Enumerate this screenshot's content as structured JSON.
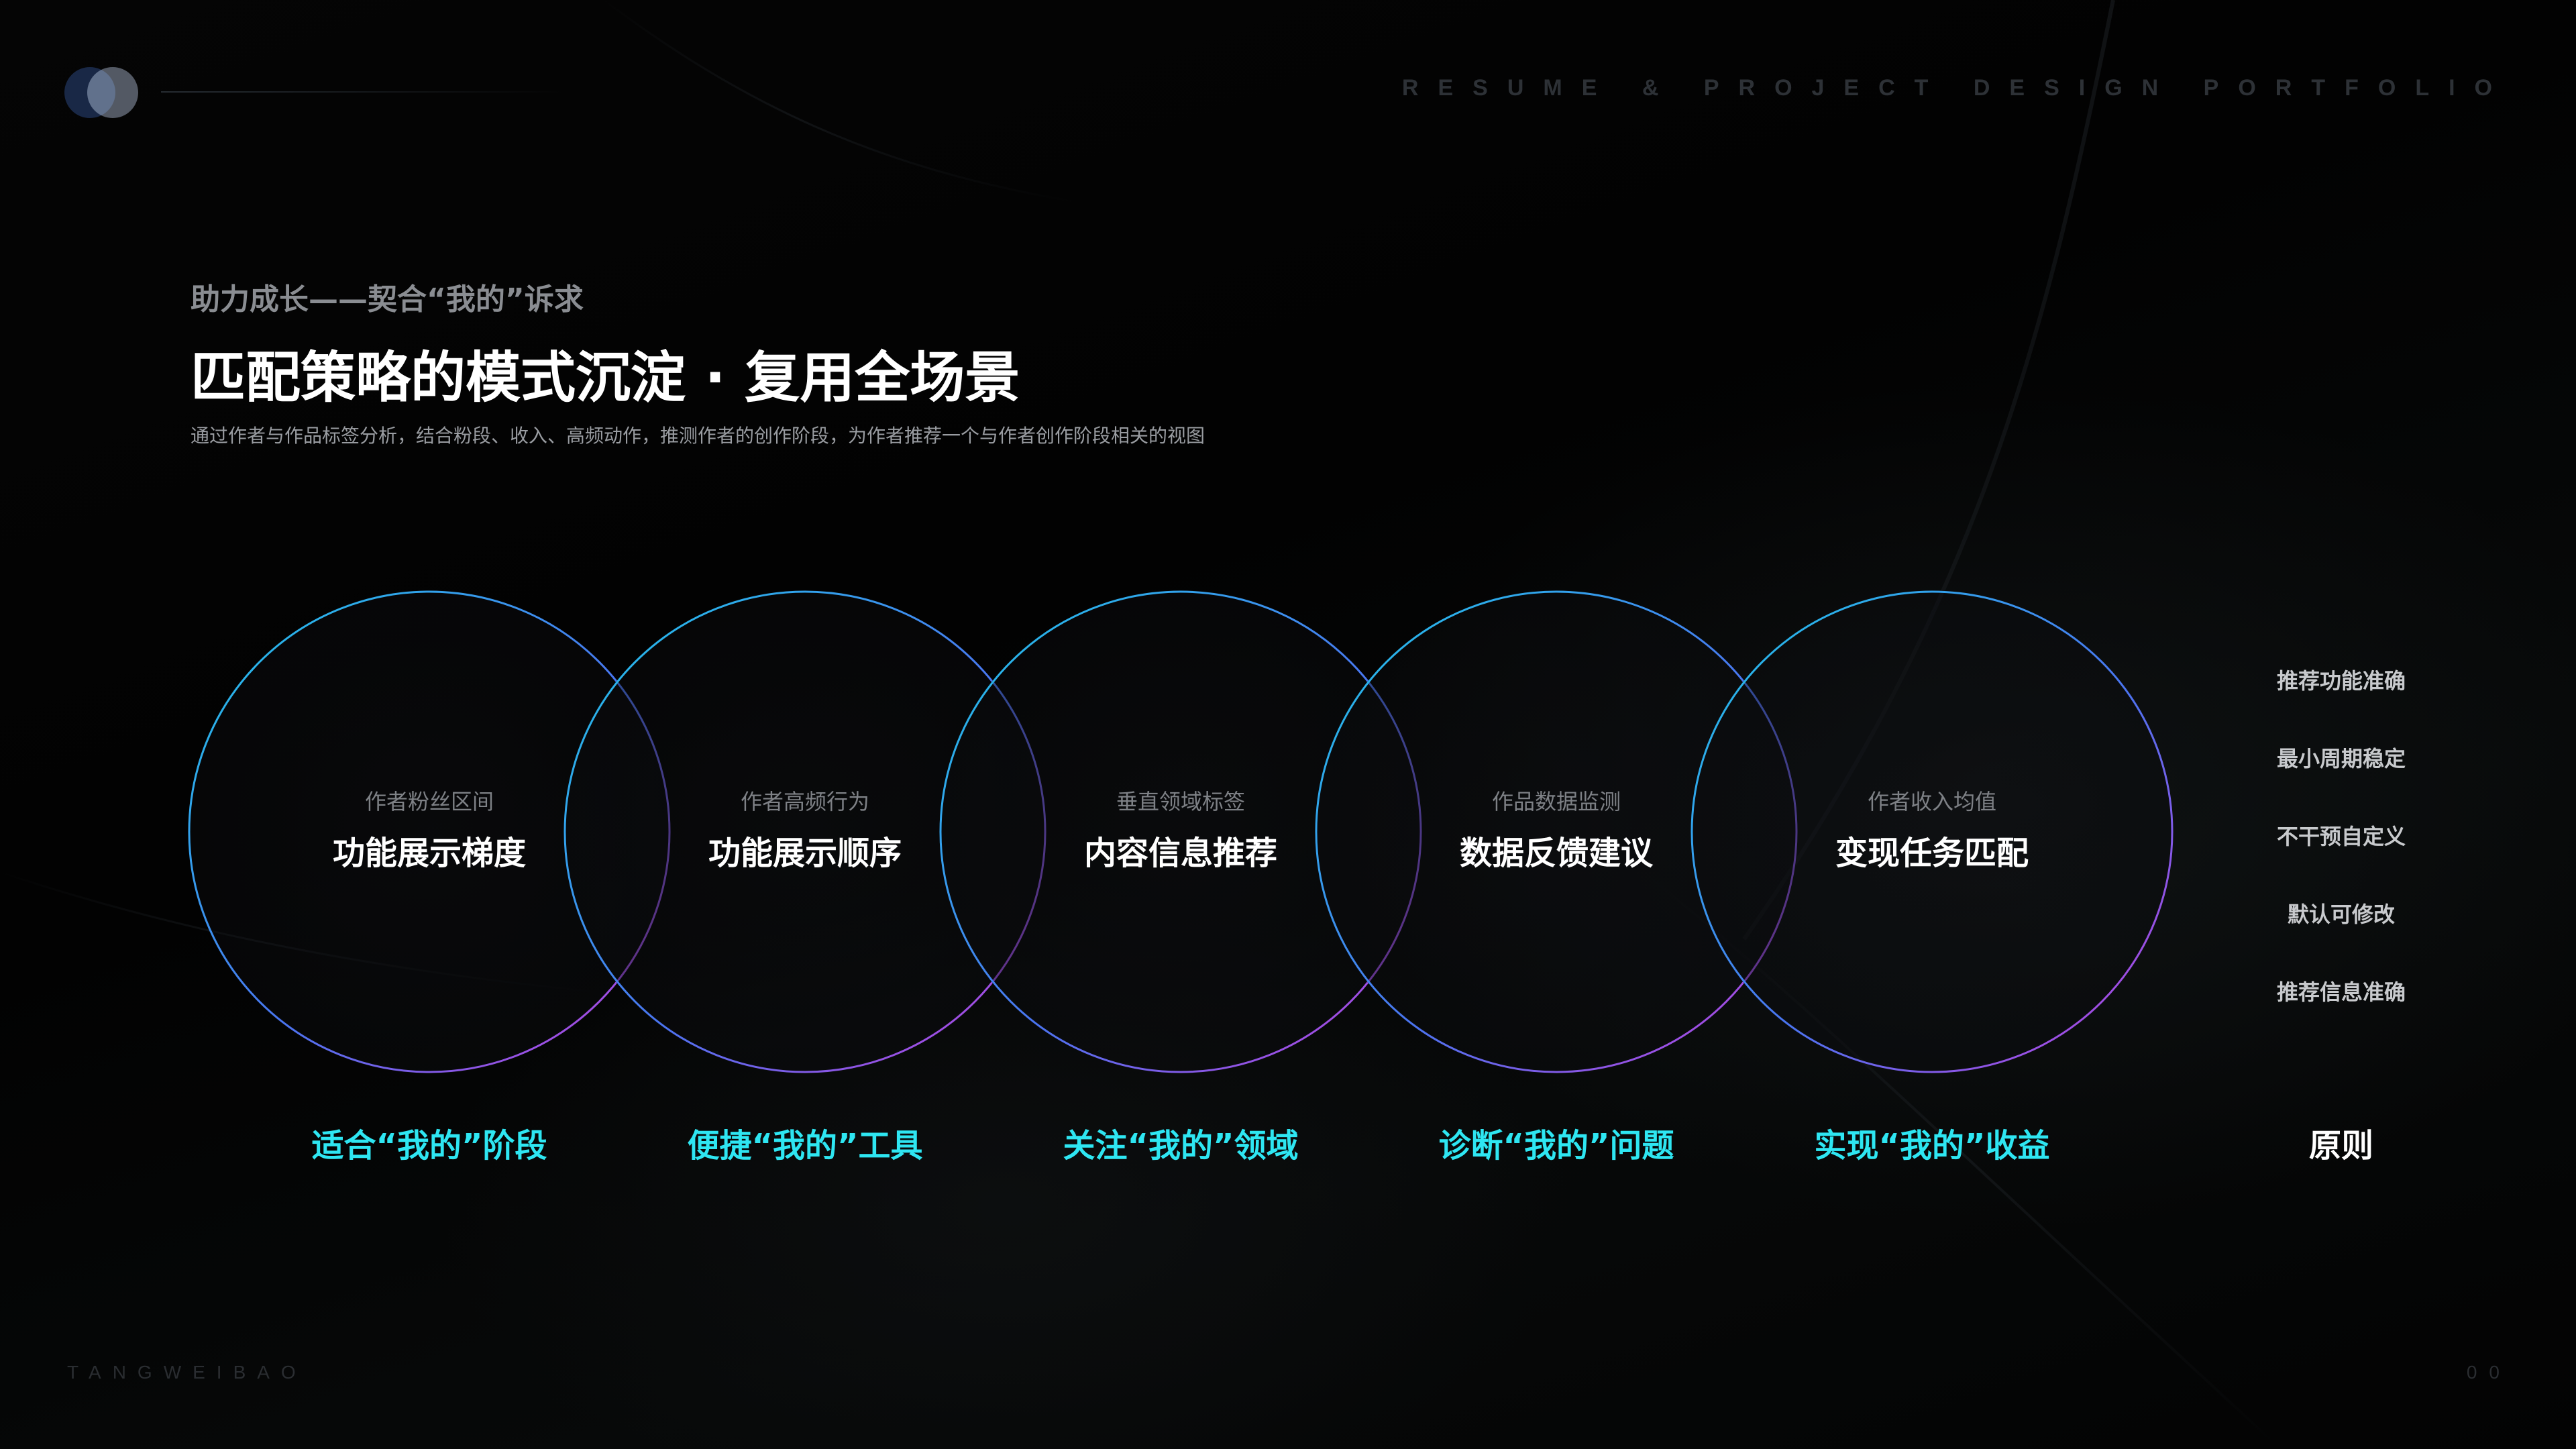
{
  "header": {
    "portfolio_title": "RESUME & PROJECT DESIGN PORTFOLIO"
  },
  "heading": {
    "kicker": "助力成长——契合“我的”诉求",
    "title": "匹配策略的模式沉淀 · 复用全场景",
    "description": "通过作者与作品标签分析，结合粉段、收入、高频动作，推测作者的创作阶段，为作者推荐一个与作者创作阶段相关的视图"
  },
  "circles": [
    {
      "subtitle": "作者粉丝区间",
      "title": "功能展示梯度",
      "caption": "适合“我的”阶段"
    },
    {
      "subtitle": "作者高频行为",
      "title": "功能展示顺序",
      "caption": "便捷“我的”工具"
    },
    {
      "subtitle": "垂直领域标签",
      "title": "内容信息推荐",
      "caption": "关注“我的”领域"
    },
    {
      "subtitle": "作品数据监测",
      "title": "数据反馈建议",
      "caption": "诊断“我的”问题"
    },
    {
      "subtitle": "作者收入均值",
      "title": "变现任务匹配",
      "caption": "实现“我的”收益"
    }
  ],
  "principles": {
    "items": [
      "推荐功能准确",
      "最小周期稳定",
      "不干预自定义",
      "默认可修改",
      "推荐信息准确"
    ],
    "label": "原则"
  },
  "footer": {
    "author": "TANGWEIBAO",
    "page_number": "00"
  },
  "colors": {
    "accent_cyan": "#2ee6f2",
    "ring_gradient_start": "#1ec8e8",
    "ring_gradient_mid": "#5a6cf0",
    "ring_gradient_end": "#c63cdc",
    "background": "#000000"
  },
  "icons": {
    "logo": "two-overlapping-circles-logo"
  }
}
